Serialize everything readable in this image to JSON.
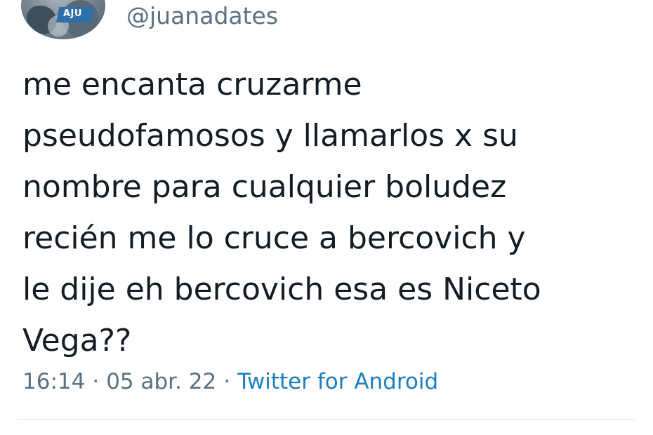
{
  "author": {
    "handle": "@juanadates",
    "avatar_icon": "profile-photo",
    "avatar_banner_text": "AJU"
  },
  "tweet": {
    "lines": [
      "me encanta cruzarme",
      "pseudofamosos y llamarlos x su",
      "nombre para cualquier boludez",
      "recién me lo cruce a bercovich y",
      "le dije eh bercovich esa es Niceto",
      "Vega??"
    ]
  },
  "meta": {
    "time": "16:14",
    "separator": "·",
    "date": "05 abr. 22",
    "source": "Twitter for Android"
  },
  "colors": {
    "text": "#141d26",
    "secondary_text": "#5b7083",
    "link": "#1d7ec2",
    "divider": "#e1e8ed",
    "background": "#ffffff"
  }
}
